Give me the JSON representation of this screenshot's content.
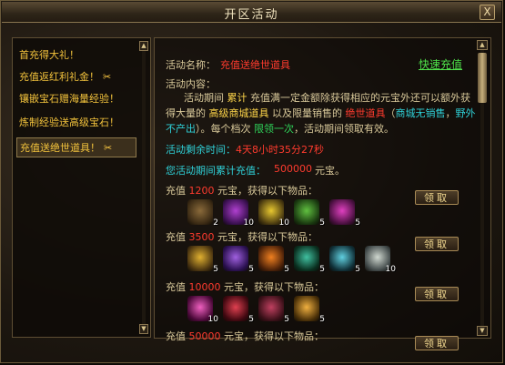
{
  "window": {
    "title": "开区活动",
    "close_label": "X"
  },
  "sidebar": {
    "items": [
      {
        "label": "首充得大礼！",
        "gift": false,
        "active": false
      },
      {
        "label": "充值返红利礼金！",
        "gift": true,
        "active": false
      },
      {
        "label": "镶嵌宝石赠海量经验！",
        "gift": false,
        "active": false
      },
      {
        "label": "炼制经验送高级宝石！",
        "gift": false,
        "active": false
      },
      {
        "label": "充值送绝世道具！",
        "gift": true,
        "active": true
      }
    ],
    "scroll_up": "▲",
    "scroll_down": "▼"
  },
  "panel": {
    "name_label": "活动名称：",
    "name_value": "充值送绝世道具",
    "quick_recharge": "快速充值",
    "content_label": "活动内容：",
    "desc": {
      "p1": "活动期间 ",
      "p2": "累计",
      "p3": " 充值满一定金额除获得相应的元宝外还可以额外获得大量的 ",
      "p4": "高级商城道具",
      "p5": " 以及限量销售的 ",
      "p6": "绝世道具",
      "p7": "（",
      "p8": "商城无销售",
      "p9": "，",
      "p10": "野外不产出",
      "p11": "）。每个档次 ",
      "p12": "限领一次",
      "p13": "，活动期间领取有效。"
    },
    "remain_label": "活动剩余时间：",
    "remain_value": "4天8小时35分27秒",
    "total_label": "您活动期间累计充值：",
    "total_value": "500000",
    "total_unit": "元宝。",
    "tiers": [
      {
        "prefix": "充值 ",
        "amount": "1200",
        "suffix": " 元宝，获得以下物品：",
        "claim": "领取",
        "items": [
          {
            "icon": "scroll-item-icon",
            "count": "2",
            "c1": "#8a6a3a",
            "c2": "#3a2a14"
          },
          {
            "icon": "potion-purple-icon",
            "count": "10",
            "c1": "#b040d0",
            "c2": "#3a1050"
          },
          {
            "icon": "star-wand-icon",
            "count": "10",
            "c1": "#e8c830",
            "c2": "#4a3a10"
          },
          {
            "icon": "potion-green-icon",
            "count": "5",
            "c1": "#60c040",
            "c2": "#1a3a10"
          },
          {
            "icon": "potion-magenta-icon",
            "count": "5",
            "c1": "#e040c0",
            "c2": "#4a1040"
          }
        ]
      },
      {
        "prefix": "充值 ",
        "amount": "3500",
        "suffix": " 元宝，获得以下物品：",
        "claim": "领取",
        "items": [
          {
            "icon": "gold-scroll-icon",
            "count": "5",
            "c1": "#e0b030",
            "c2": "#4a3410"
          },
          {
            "icon": "purple-orb-icon",
            "count": "5",
            "c1": "#a060e0",
            "c2": "#2a1050"
          },
          {
            "icon": "fire-ring-icon",
            "count": "5",
            "c1": "#f08020",
            "c2": "#4a2008"
          },
          {
            "icon": "green-gem-icon",
            "count": "5",
            "c1": "#40c0a0",
            "c2": "#0a3020"
          },
          {
            "icon": "cyan-ring-icon",
            "count": "5",
            "c1": "#60d0e0",
            "c2": "#103038"
          },
          {
            "icon": "silver-egg-icon",
            "count": "10",
            "c1": "#d0d8d0",
            "c2": "#404848"
          }
        ]
      },
      {
        "prefix": "充值 ",
        "amount": "10000",
        "suffix": " 元宝，获得以下物品：",
        "claim": "领取",
        "items": [
          {
            "icon": "pink-crystal-icon",
            "count": "10",
            "c1": "#f060c0",
            "c2": "#4a0838"
          },
          {
            "icon": "red-orb-icon",
            "count": "5",
            "c1": "#e04050",
            "c2": "#400810"
          },
          {
            "icon": "spellbook-icon",
            "count": "5",
            "c1": "#c04060",
            "c2": "#3a1018"
          },
          {
            "icon": "gold-egg-icon",
            "count": "5",
            "c1": "#f0b040",
            "c2": "#4a3008"
          }
        ]
      },
      {
        "prefix": "充值 ",
        "amount": "50000",
        "suffix": " 元宝，获得以下物品：",
        "claim": "领取",
        "items": []
      }
    ]
  },
  "colors": {
    "gold": "#f2c23c",
    "red": "#ff3b2e",
    "green": "#2fd35a",
    "cyan": "#2fd1d8"
  }
}
